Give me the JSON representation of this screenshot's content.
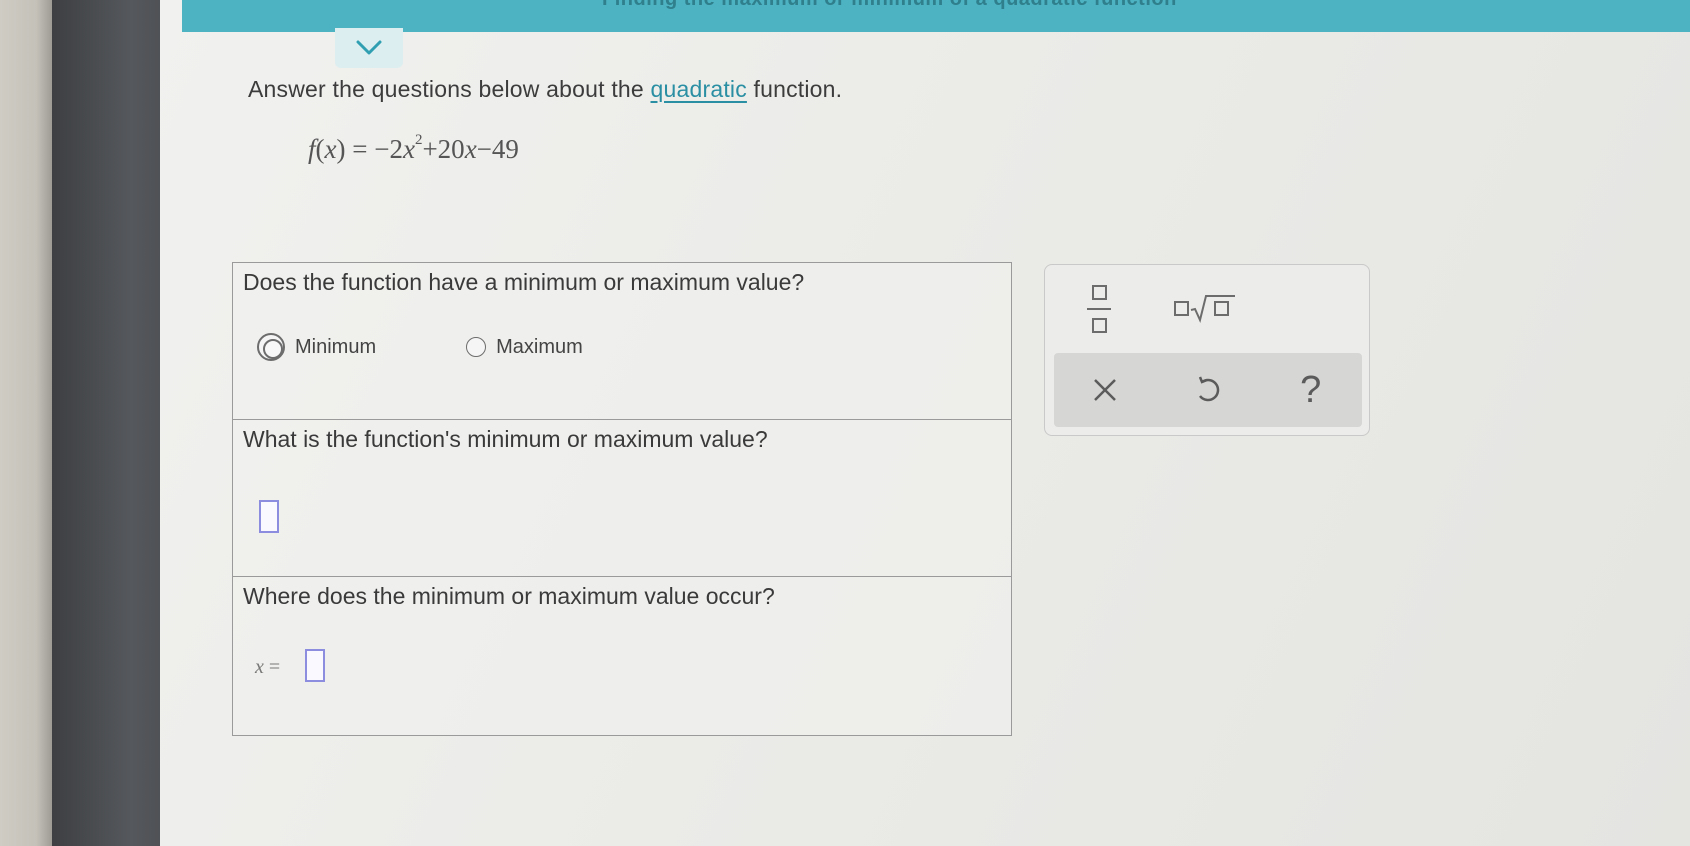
{
  "header": {
    "title": "Finding the maximum or minimum of a quadratic function",
    "color": "#4db3c3"
  },
  "instruction": {
    "before": "Answer the questions below about the ",
    "term": "quadratic",
    "after": " function."
  },
  "formula": {
    "fx": "f",
    "x": "x",
    "eq": " = −2",
    "x1": "x",
    "exp": "2",
    "mid": "+20",
    "x2": "x",
    "end": "−49"
  },
  "questions": {
    "q1": {
      "text": "Does the function have a minimum or maximum value?",
      "options": [
        {
          "label": "Minimum",
          "selected": true
        },
        {
          "label": "Maximum",
          "selected": false
        }
      ]
    },
    "q2": {
      "text": "What is the function's minimum or maximum value?"
    },
    "q3": {
      "text": "Where does the minimum or maximum value occur?",
      "var": "x",
      "eq": "="
    }
  },
  "tools": {
    "fraction": "fraction-template-icon",
    "sqrt": "mixed-sqrt-template-icon",
    "clear": "×",
    "undo": "undo-icon",
    "help": "?"
  },
  "colors": {
    "accent": "#2a8fa3",
    "answer_box": "#8d8de0"
  }
}
